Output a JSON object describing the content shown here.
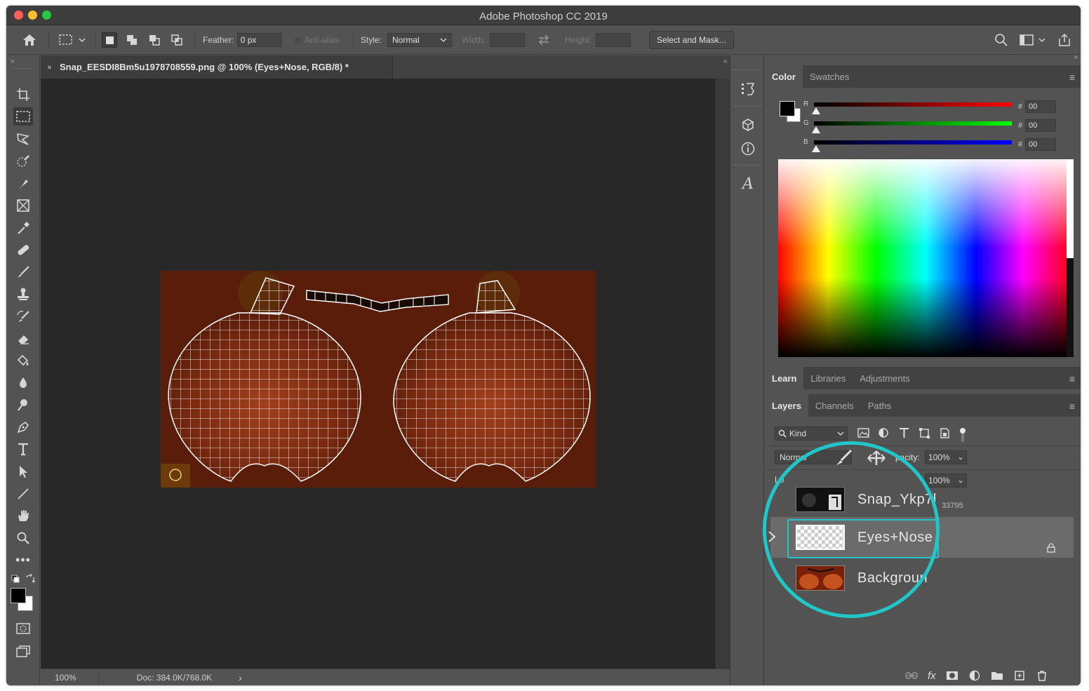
{
  "window": {
    "title": "Adobe Photoshop CC 2019"
  },
  "options_bar": {
    "feather_label": "Feather:",
    "feather_value": "0 px",
    "antialias_label": "Anti-alias",
    "style_label": "Style:",
    "style_value": "Normal",
    "width_label": "Width:",
    "height_label": "Height:",
    "select_mask_label": "Select and Mask..."
  },
  "document": {
    "tab_title": "Snap_EESDI8Bm5u1978708559.png @ 100% (Eyes+Nose, RGB/8) *",
    "close_glyph": "×"
  },
  "status_bar": {
    "zoom": "100%",
    "doc_size": "Doc: 384.0K/768.0K",
    "arrow": "›"
  },
  "color_panel": {
    "tabs": [
      "Color",
      "Swatches"
    ],
    "r_label": "R",
    "g_label": "G",
    "b_label": "B",
    "r_value": "00",
    "g_value": "00",
    "b_value": "00",
    "hash": "#"
  },
  "learn_panel": {
    "tabs": [
      "Learn",
      "Libraries",
      "Adjustments"
    ]
  },
  "layers_panel": {
    "tabs": [
      "Layers",
      "Channels",
      "Paths"
    ],
    "filter_label": "Kind",
    "blend_mode": "Normal",
    "opacity_label": "pacity:",
    "opacity_value": "100%",
    "lock_label": "Lo",
    "fill_value": "100%",
    "layers": [
      {
        "name": "Snap_Ykp7l",
        "suffix": "33795"
      },
      {
        "name": "Eyes+Nose"
      },
      {
        "name": "Backgroun"
      }
    ]
  },
  "colors": {
    "highlight": "#20c6c8",
    "image_bg": "#5a1d0a"
  }
}
